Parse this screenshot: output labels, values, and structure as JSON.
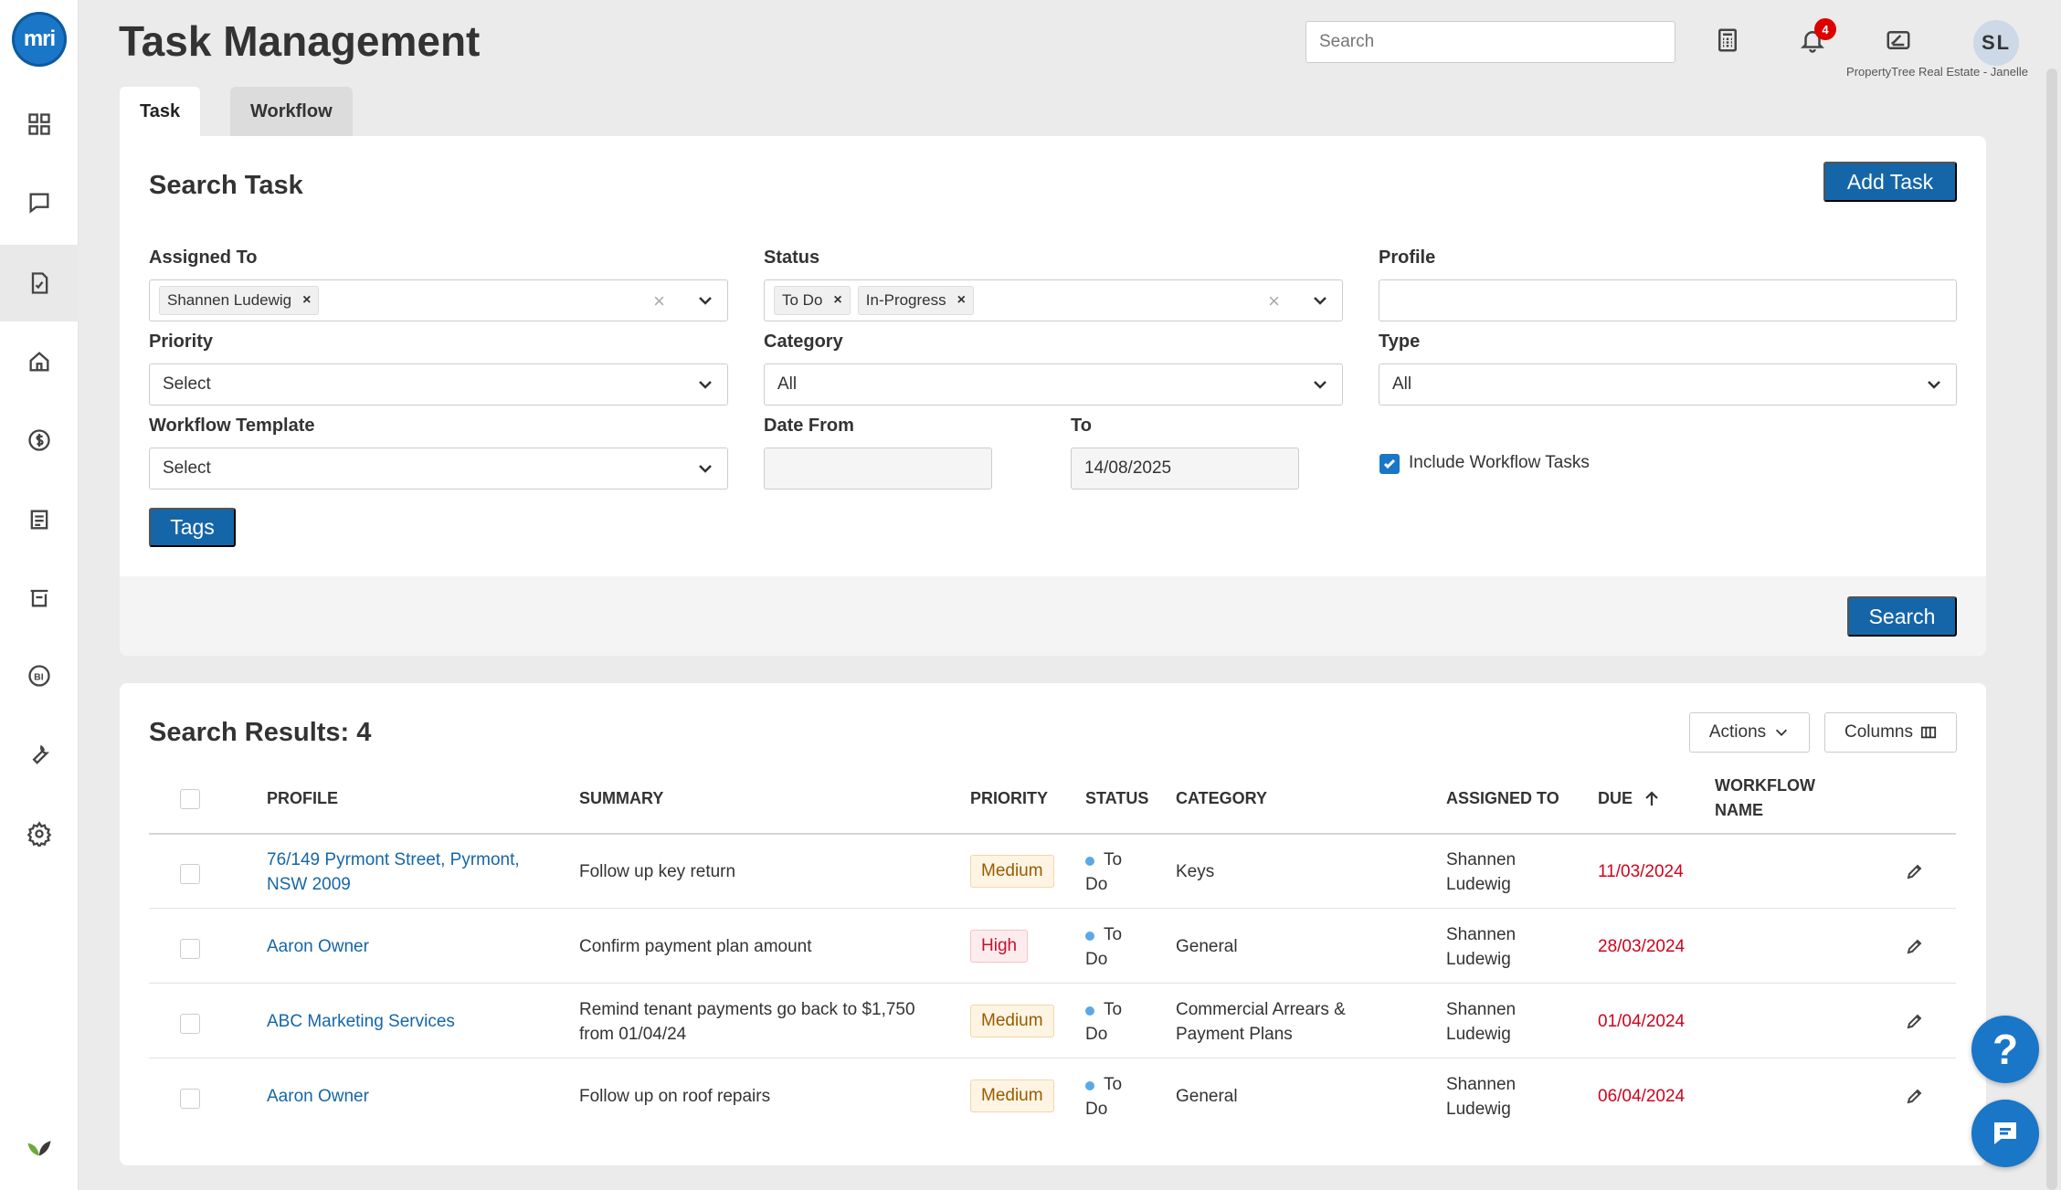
{
  "app": {
    "page_title": "Task Management",
    "search_placeholder": "Search",
    "notification_count": "4",
    "user_initials": "SL",
    "user_caption": "PropertyTree Real Estate - Janelle",
    "logo_text": "mri"
  },
  "sidebar": {
    "items": [
      {
        "icon": "dashboard-icon"
      },
      {
        "icon": "messages-icon"
      },
      {
        "icon": "tasks-icon",
        "active": true
      },
      {
        "icon": "property-icon"
      },
      {
        "icon": "finance-icon"
      },
      {
        "icon": "documents-icon"
      },
      {
        "icon": "inspections-icon"
      },
      {
        "icon": "bi-icon"
      },
      {
        "icon": "tools-icon"
      },
      {
        "icon": "settings-icon"
      }
    ]
  },
  "tabs": [
    {
      "label": "Task",
      "active": true
    },
    {
      "label": "Workflow",
      "active": false
    }
  ],
  "search_task": {
    "title": "Search Task",
    "add_button": "Add Task",
    "assigned_to": {
      "label": "Assigned To",
      "chips": [
        "Shannen Ludewig"
      ]
    },
    "status": {
      "label": "Status",
      "chips": [
        "To Do",
        "In-Progress"
      ]
    },
    "profile": {
      "label": "Profile",
      "value": ""
    },
    "priority": {
      "label": "Priority",
      "value": "Select"
    },
    "category": {
      "label": "Category",
      "value": "All"
    },
    "type": {
      "label": "Type",
      "value": "All"
    },
    "workflow_template": {
      "label": "Workflow Template",
      "value": "Select"
    },
    "date_from": {
      "label": "Date From",
      "value": ""
    },
    "date_to": {
      "label": "To",
      "value": "14/08/2025"
    },
    "include_workflow": {
      "label": "Include Workflow Tasks",
      "checked": true
    },
    "tags_button": "Tags",
    "search_button": "Search"
  },
  "results": {
    "title": "Search Results: 4",
    "actions_button": "Actions",
    "columns_button": "Columns",
    "headers": {
      "profile": "PROFILE",
      "summary": "SUMMARY",
      "priority": "PRIORITY",
      "status": "STATUS",
      "category": "CATEGORY",
      "assigned_to": "ASSIGNED TO",
      "due": "DUE",
      "workflow_name_1": "WORKFLOW",
      "workflow_name_2": "NAME"
    },
    "rows": [
      {
        "profile_1": "76/149 Pyrmont Street, Pyrmont,",
        "profile_2": "NSW 2009",
        "summary_1": "Follow up key return",
        "summary_2": "",
        "priority": "Medium",
        "status_1": "To",
        "status_2": "Do",
        "category_1": "Keys",
        "category_2": "",
        "assigned_1": "Shannen",
        "assigned_2": "Ludewig",
        "due": "11/03/2024"
      },
      {
        "profile_1": "Aaron Owner",
        "profile_2": "",
        "summary_1": "Confirm payment plan amount",
        "summary_2": "",
        "priority": "High",
        "status_1": "To",
        "status_2": "Do",
        "category_1": "General",
        "category_2": "",
        "assigned_1": "Shannen",
        "assigned_2": "Ludewig",
        "due": "28/03/2024"
      },
      {
        "profile_1": "ABC Marketing Services",
        "profile_2": "",
        "summary_1": "Remind tenant payments go back to $1,750",
        "summary_2": "from 01/04/24",
        "priority": "Medium",
        "status_1": "To",
        "status_2": "Do",
        "category_1": "Commercial Arrears &",
        "category_2": "Payment Plans",
        "assigned_1": "Shannen",
        "assigned_2": "Ludewig",
        "due": "01/04/2024"
      },
      {
        "profile_1": "Aaron Owner",
        "profile_2": "",
        "summary_1": "Follow up on roof repairs",
        "summary_2": "",
        "priority": "Medium",
        "status_1": "To",
        "status_2": "Do",
        "category_1": "General",
        "category_2": "",
        "assigned_1": "Shannen",
        "assigned_2": "Ludewig",
        "due": "06/04/2024"
      }
    ]
  },
  "help_button": "?",
  "colors": {
    "primary": "#1566a8",
    "due_red": "#d0021b",
    "medium_text": "#9a5b00",
    "high_text": "#c8102e"
  }
}
